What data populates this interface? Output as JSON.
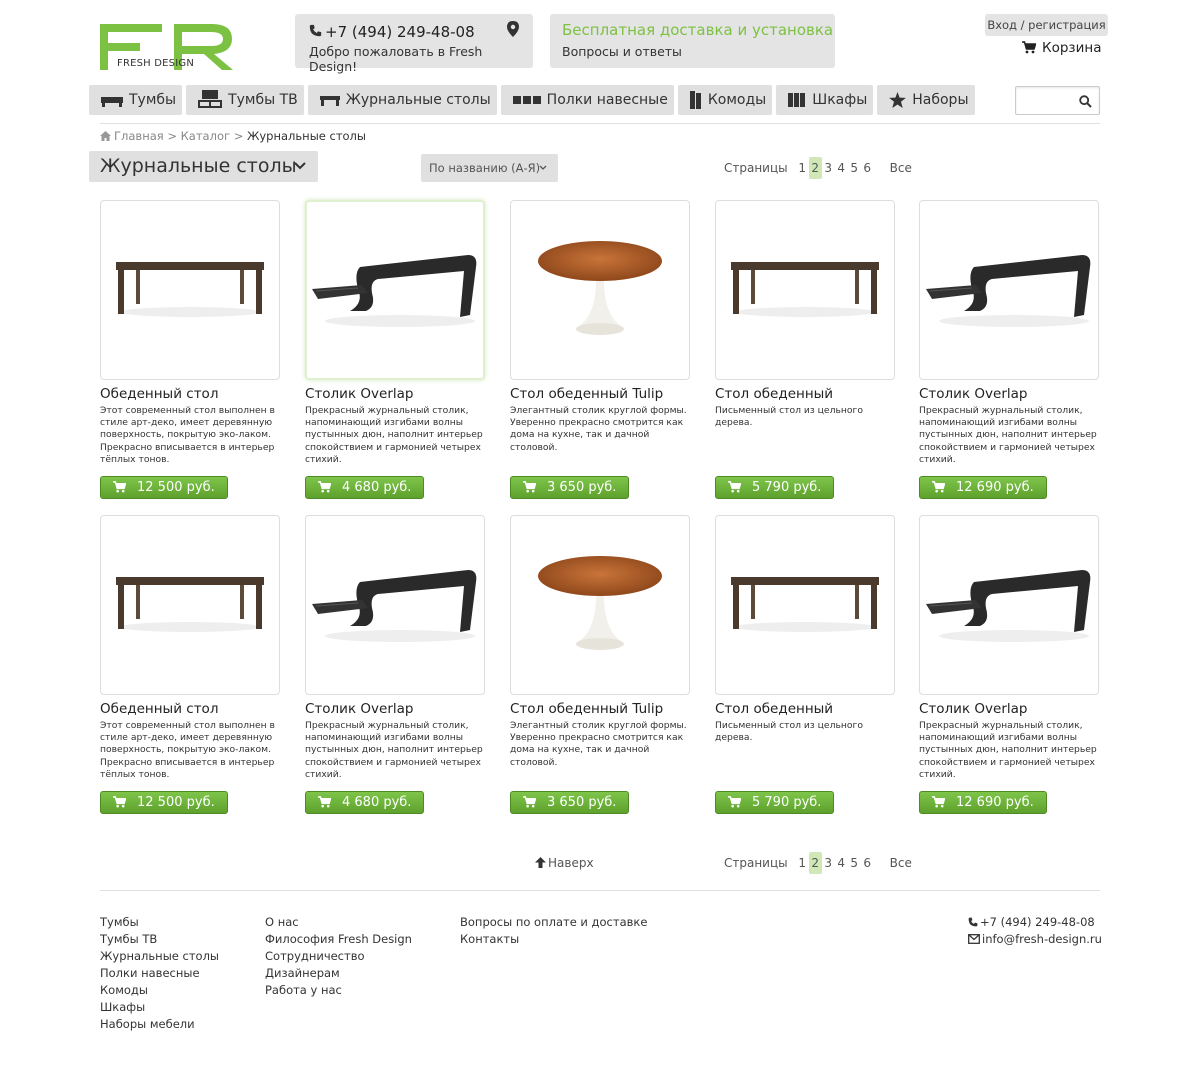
{
  "brand": {
    "logo_text": "FRESH DESIGN",
    "accent": "#7dc143"
  },
  "header": {
    "phone": "+7 (494) 249-48-08",
    "welcome": "Добро пожаловать в Fresh Design!",
    "delivery": "Бесплатная доставка и установка",
    "faq": "Вопросы и ответы",
    "login": "Вход / регистрация",
    "cart": "Корзина"
  },
  "nav": [
    {
      "label": "Тумбы",
      "icon": "tumba-icon"
    },
    {
      "label": "Тумбы ТВ",
      "icon": "tv-stand-icon"
    },
    {
      "label": "Журнальные столы",
      "icon": "coffee-table-icon"
    },
    {
      "label": "Полки навесные",
      "icon": "shelf-icon"
    },
    {
      "label": "Комоды",
      "icon": "dresser-icon"
    },
    {
      "label": "Шкафы",
      "icon": "wardrobe-icon"
    },
    {
      "label": "Наборы",
      "icon": "star-icon"
    }
  ],
  "search": {
    "placeholder": ""
  },
  "breadcrumb": {
    "home": "Главная",
    "sep": ">",
    "catalog": "Каталог",
    "current": "Журнальные столы"
  },
  "category_title": "Журнальные столы",
  "sort": "По названию (А-Я)",
  "pager": {
    "label": "Страницы",
    "pages": [
      "1",
      "2",
      "3",
      "4",
      "5",
      "6"
    ],
    "active": "2",
    "all": "Все"
  },
  "products": [
    {
      "name": "Обеденный стол",
      "desc": "Этот современный стол выполнен в стиле арт-деко, имеет деревянную поверхность, покрытую эко-лаком. Прекрасно вписывается в интерьер тёплых тонов.",
      "price": "12 500 руб.",
      "img": "wood-table"
    },
    {
      "name": "Столик Overlap",
      "desc": "Прекрасный журнальный столик, напоминающий изгибами волны пустынных дюн, наполнит интерьер спокойствием и гармонией четырех стихий.",
      "price": "4 680 руб.",
      "img": "overlap"
    },
    {
      "name": "Стол обеденный Tulip",
      "desc": "Элегантный столик круглой формы. Уверенно прекрасно смотрится как дома на кухне, так и дачной столовой.",
      "price": "3 650 руб.",
      "img": "tulip"
    },
    {
      "name": "Стол обеденный",
      "desc": "Письменный стол из цельного дерева.",
      "price": "5 790 руб.",
      "img": "wood-table"
    },
    {
      "name": "Столик Overlap",
      "desc": "Прекрасный журнальный столик, напоминающий изгибами волны пустынных дюн, наполнит интерьер спокойствием и гармонией четырех стихий.",
      "price": "12 690 руб.",
      "img": "overlap"
    },
    {
      "name": "Обеденный стол",
      "desc": "Этот современный стол выполнен в стиле арт-деко, имеет деревянную поверхность, покрытую эко-лаком. Прекрасно вписывается в интерьер тёплых тонов.",
      "price": "12 500 руб.",
      "img": "wood-table"
    },
    {
      "name": "Столик Overlap",
      "desc": "Прекрасный журнальный столик, напоминающий изгибами волны пустынных дюн, наполнит интерьер спокойствием и гармонией четырех стихий.",
      "price": "4 680 руб.",
      "img": "overlap"
    },
    {
      "name": "Стол обеденный Tulip",
      "desc": "Элегантный столик круглой формы. Уверенно прекрасно смотрится как дома на кухне, так и дачной столовой.",
      "price": "3 650 руб.",
      "img": "tulip"
    },
    {
      "name": "Стол обеденный",
      "desc": "Письменный стол из цельного дерева.",
      "price": "5 790 руб.",
      "img": "wood-table"
    },
    {
      "name": "Столик Overlap",
      "desc": "Прекрасный журнальный столик, напоминающий изгибами волны пустынных дюн, наполнит интерьер спокойствием и гармонией четырех стихий.",
      "price": "12 690 руб.",
      "img": "overlap"
    }
  ],
  "up_link": "Наверх",
  "footer": {
    "col1": [
      "Тумбы",
      "Тумбы ТВ",
      "Журнальные столы",
      "Полки навесные",
      "Комоды",
      "Шкафы",
      "Наборы мебели"
    ],
    "col2": [
      "О нас",
      "Философия Fresh Design",
      "Сотрудничество",
      "Дизайнерам",
      "Работа у нас"
    ],
    "col3": [
      "Вопросы по оплате и доставке",
      "Контакты"
    ],
    "phone": "+7 (494) 249-48-08",
    "email": "info@fresh-design.ru"
  }
}
